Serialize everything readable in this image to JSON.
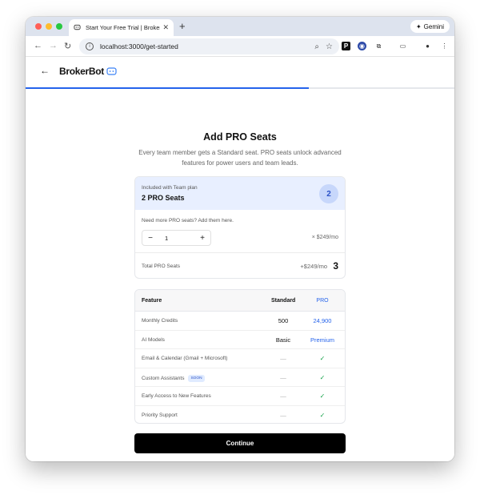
{
  "browser": {
    "tab_title": "Start Your Free Trial | BrokerB",
    "url": "localhost:3000/get-started",
    "gemini_label": "Gemini"
  },
  "header": {
    "logo_text": "BrokerBot",
    "progress_fraction": 0.66
  },
  "main": {
    "title": "Add PRO Seats",
    "subtitle": "Every team member gets a Standard seat. PRO seats unlock advanced features for power users and team leads."
  },
  "seats": {
    "included_label": "Included with Team plan",
    "included_value": "2 PRO Seats",
    "included_count": "2",
    "need_more_label": "Need more PRO seats? Add them here.",
    "quantity": "1",
    "per_seat_price": "× $249/mo",
    "total_label": "Total PRO Seats",
    "total_price": "+$249/mo",
    "total_count": "3"
  },
  "comparison": {
    "headers": {
      "feature": "Feature",
      "standard": "Standard",
      "pro": "PRO"
    },
    "rows": [
      {
        "feature": "Monthly Credits",
        "standard": "500",
        "pro": "24,900"
      },
      {
        "feature": "AI Models",
        "standard": "Basic",
        "pro": "Premium"
      },
      {
        "feature": "Email & Calendar (Gmail + Microsoft)",
        "standard": "—",
        "pro": "✓"
      },
      {
        "feature": "Custom Assistants",
        "badge": "SOON",
        "standard": "—",
        "pro": "✓"
      },
      {
        "feature": "Early Access to New Features",
        "standard": "—",
        "pro": "✓"
      },
      {
        "feature": "Priority Support",
        "standard": "—",
        "pro": "✓"
      }
    ]
  },
  "actions": {
    "continue_label": "Continue"
  },
  "colors": {
    "accent": "#2563eb",
    "success": "#16a34a",
    "highlight_bg": "#e8efff"
  }
}
